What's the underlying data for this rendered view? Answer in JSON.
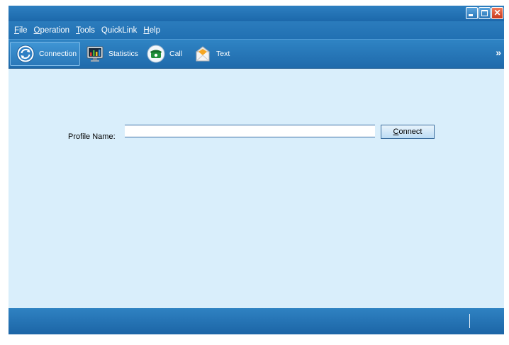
{
  "window": {
    "controls": {
      "minimize_icon": "minimize-icon",
      "maximize_icon": "maximize-icon",
      "close_icon": "close-icon"
    }
  },
  "menu": {
    "items": [
      {
        "label": "File",
        "underline": "F",
        "rest": "ile"
      },
      {
        "label": "Operation",
        "underline": "O",
        "rest": "peration"
      },
      {
        "label": "Tools",
        "underline": "T",
        "rest": "ools"
      },
      {
        "label": "QuickLink",
        "underline": "",
        "rest": "QuickLink"
      },
      {
        "label": "Help",
        "underline": "H",
        "rest": "elp"
      }
    ]
  },
  "toolbar": {
    "items": [
      {
        "label": "Connection",
        "icon": "connection-refresh-icon",
        "active": true
      },
      {
        "label": "Statistics",
        "icon": "statistics-monitor-icon",
        "active": false
      },
      {
        "label": "Call",
        "icon": "phone-icon",
        "active": false
      },
      {
        "label": "Text",
        "icon": "envelope-icon",
        "active": false
      }
    ],
    "overflow": "»"
  },
  "main": {
    "profile_label": "Profile Name:",
    "profile_value": "",
    "connect_underline": "C",
    "connect_rest": "onnect"
  },
  "colors": {
    "chrome_blue": "#1f6aab",
    "content_bg": "#d9eefb"
  }
}
